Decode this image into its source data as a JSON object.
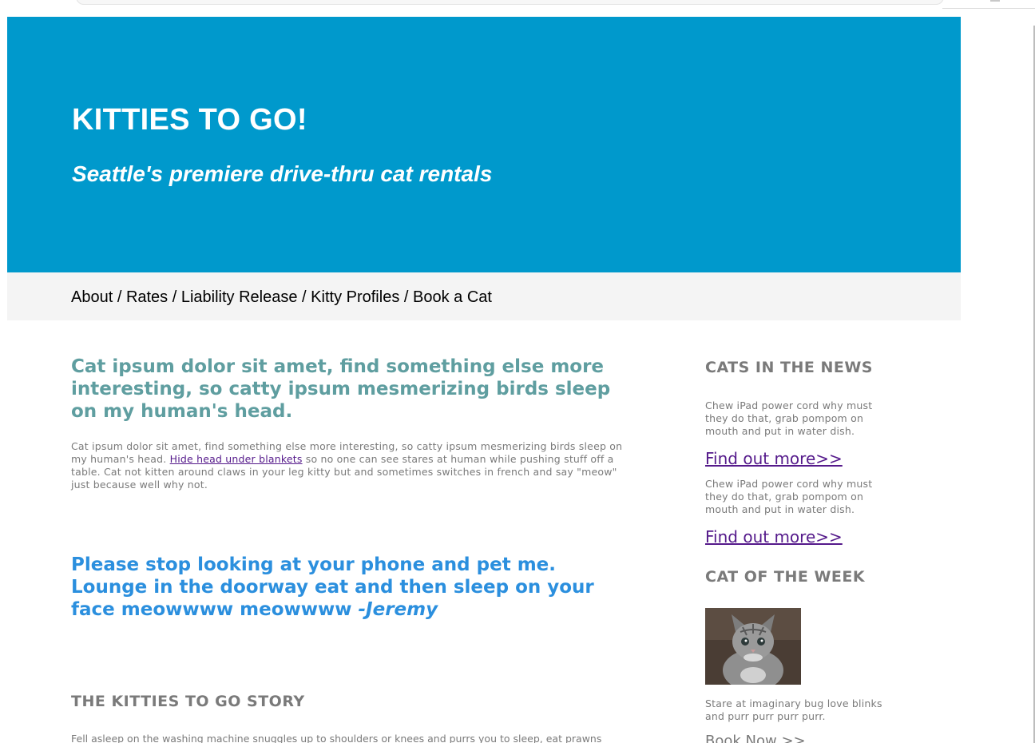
{
  "header": {
    "title": "KITTIES TO GO!",
    "tagline": "Seattle's premiere drive-thru cat rentals"
  },
  "nav": {
    "items": [
      "About",
      "Rates",
      "Liability Release",
      "Kitty Profiles",
      "Book a Cat"
    ],
    "separator": " / "
  },
  "main": {
    "intro_heading": "Cat ipsum dolor sit amet, find something else more interesting, so catty ipsum mesmerizing birds sleep on my human's head.",
    "body_before_link": "Cat ipsum dolor sit amet, find something else more interesting, so catty ipsum mesmerizing birds sleep on my human's head. ",
    "body_link": "Hide head under blankets",
    "body_after_link": " so no one can see stares at human while pushing stuff off a table. Cat not kitten around claws in your leg kitty but and sometimes switches in french and say \"meow\" just because well why not.",
    "quote_text": "Please stop looking at your phone and pet me. Lounge in the doorway eat and then sleep on your face meowwww meowwww ",
    "quote_author": "-Jeremy",
    "story_title": "THE KITTIES TO GO STORY",
    "story_text": "Fell asleep on the washing machine snuggles up to shoulders or knees and purrs you to sleep, eat prawns"
  },
  "sidebar": {
    "news_title": "CATS IN THE NEWS",
    "news_items": [
      {
        "text": "Chew iPad power cord why must they do that, grab pompom on mouth and put in water dish.",
        "link": "Find out more>>"
      },
      {
        "text": "Chew iPad power cord why must they do that, grab pompom on mouth and put in water dish.",
        "link": "Find out more>>"
      }
    ],
    "cotw_title": "CAT OF THE WEEK",
    "cat_caption": "Stare at imaginary bug love blinks and purr purr purr purr.",
    "book_now": "Book Now >>"
  },
  "colors": {
    "header_bg": "#0099cc",
    "nav_bg": "#f4f4f4",
    "intro_heading": "#5f9ea0",
    "quote": "#2b8fde",
    "muted_text": "#7a7a7a",
    "visited_link": "#551a8b"
  }
}
